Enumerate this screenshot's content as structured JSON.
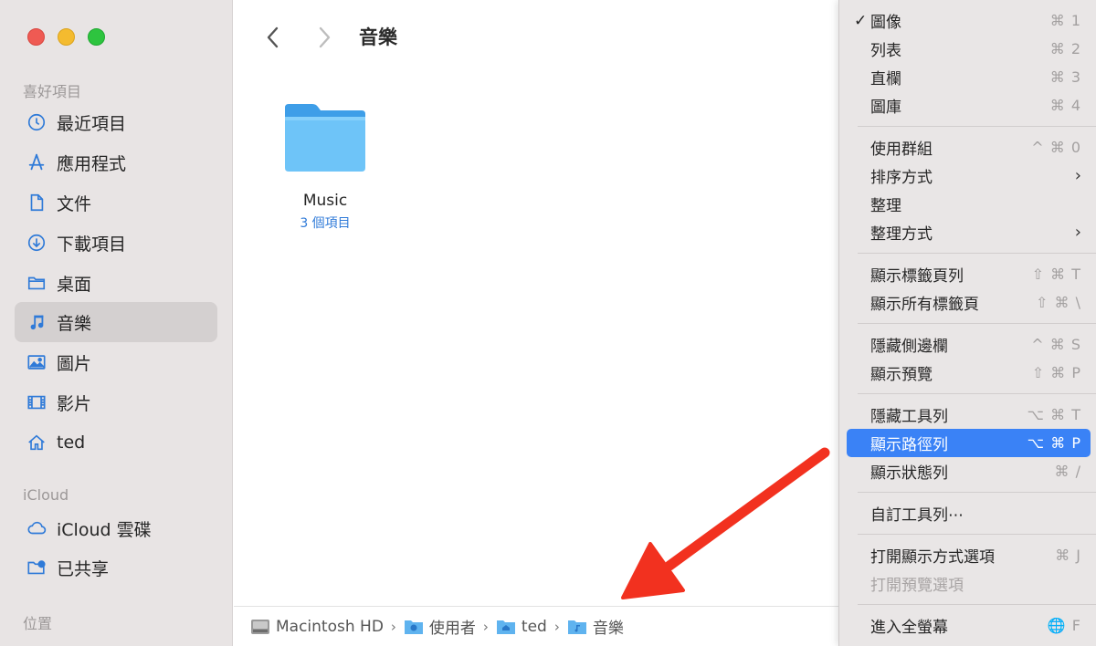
{
  "sidebar": {
    "favorites_title": "喜好項目",
    "icloud_title": "iCloud",
    "locations_title": "位置",
    "items": [
      {
        "label": "最近項目",
        "icon": "clock-icon"
      },
      {
        "label": "應用程式",
        "icon": "app-store-icon"
      },
      {
        "label": "文件",
        "icon": "document-icon"
      },
      {
        "label": "下載項目",
        "icon": "download-icon"
      },
      {
        "label": "桌面",
        "icon": "folder-icon"
      },
      {
        "label": "音樂",
        "icon": "music-note-icon"
      },
      {
        "label": "圖片",
        "icon": "photo-icon"
      },
      {
        "label": "影片",
        "icon": "film-icon"
      },
      {
        "label": "ted",
        "icon": "home-icon"
      }
    ],
    "icloud_items": [
      {
        "label": "iCloud 雲碟",
        "icon": "cloud-icon"
      },
      {
        "label": "已共享",
        "icon": "shared-folder-icon"
      }
    ]
  },
  "window": {
    "title": "音樂"
  },
  "folder": {
    "name": "Music",
    "subtitle": "3 個項目"
  },
  "pathbar": {
    "crumbs": [
      "Macintosh HD",
      "使用者",
      "ted",
      "音樂"
    ]
  },
  "menu": {
    "items": [
      {
        "label": "圖像",
        "shortcut": "⌘ 1",
        "checked": true
      },
      {
        "label": "列表",
        "shortcut": "⌘ 2"
      },
      {
        "label": "直欄",
        "shortcut": "⌘ 3"
      },
      {
        "label": "圖庫",
        "shortcut": "⌘ 4"
      },
      {
        "label": "使用群組",
        "shortcut": "^ ⌘ 0"
      },
      {
        "label": "排序方式",
        "shortcut": ""
      },
      {
        "label": "整理",
        "shortcut": ""
      },
      {
        "label": "整理方式",
        "shortcut": ""
      },
      {
        "label": "顯示標籤頁列",
        "shortcut": "⇧ ⌘ T"
      },
      {
        "label": "顯示所有標籤頁",
        "shortcut": "⇧ ⌘ \\"
      },
      {
        "label": "隱藏側邊欄",
        "shortcut": "^ ⌘ S"
      },
      {
        "label": "顯示預覽",
        "shortcut": "⇧ ⌘ P"
      },
      {
        "label": "隱藏工具列",
        "shortcut": "⌥ ⌘ T"
      },
      {
        "label": "顯示路徑列",
        "shortcut": "⌥ ⌘ P"
      },
      {
        "label": "顯示狀態列",
        "shortcut": "⌘ /"
      },
      {
        "label": "自訂工具列⋯",
        "shortcut": ""
      },
      {
        "label": "打開顯示方式選項",
        "shortcut": "⌘ J"
      },
      {
        "label": "打開預覽選項",
        "shortcut": ""
      },
      {
        "label": "進入全螢幕",
        "shortcut": "🌐 F"
      }
    ],
    "check_mark": "✓",
    "chevron": "›"
  },
  "colors": {
    "accent": "#3a82f6",
    "arrow": "#f2311f",
    "folder": "#5fb9f5"
  }
}
